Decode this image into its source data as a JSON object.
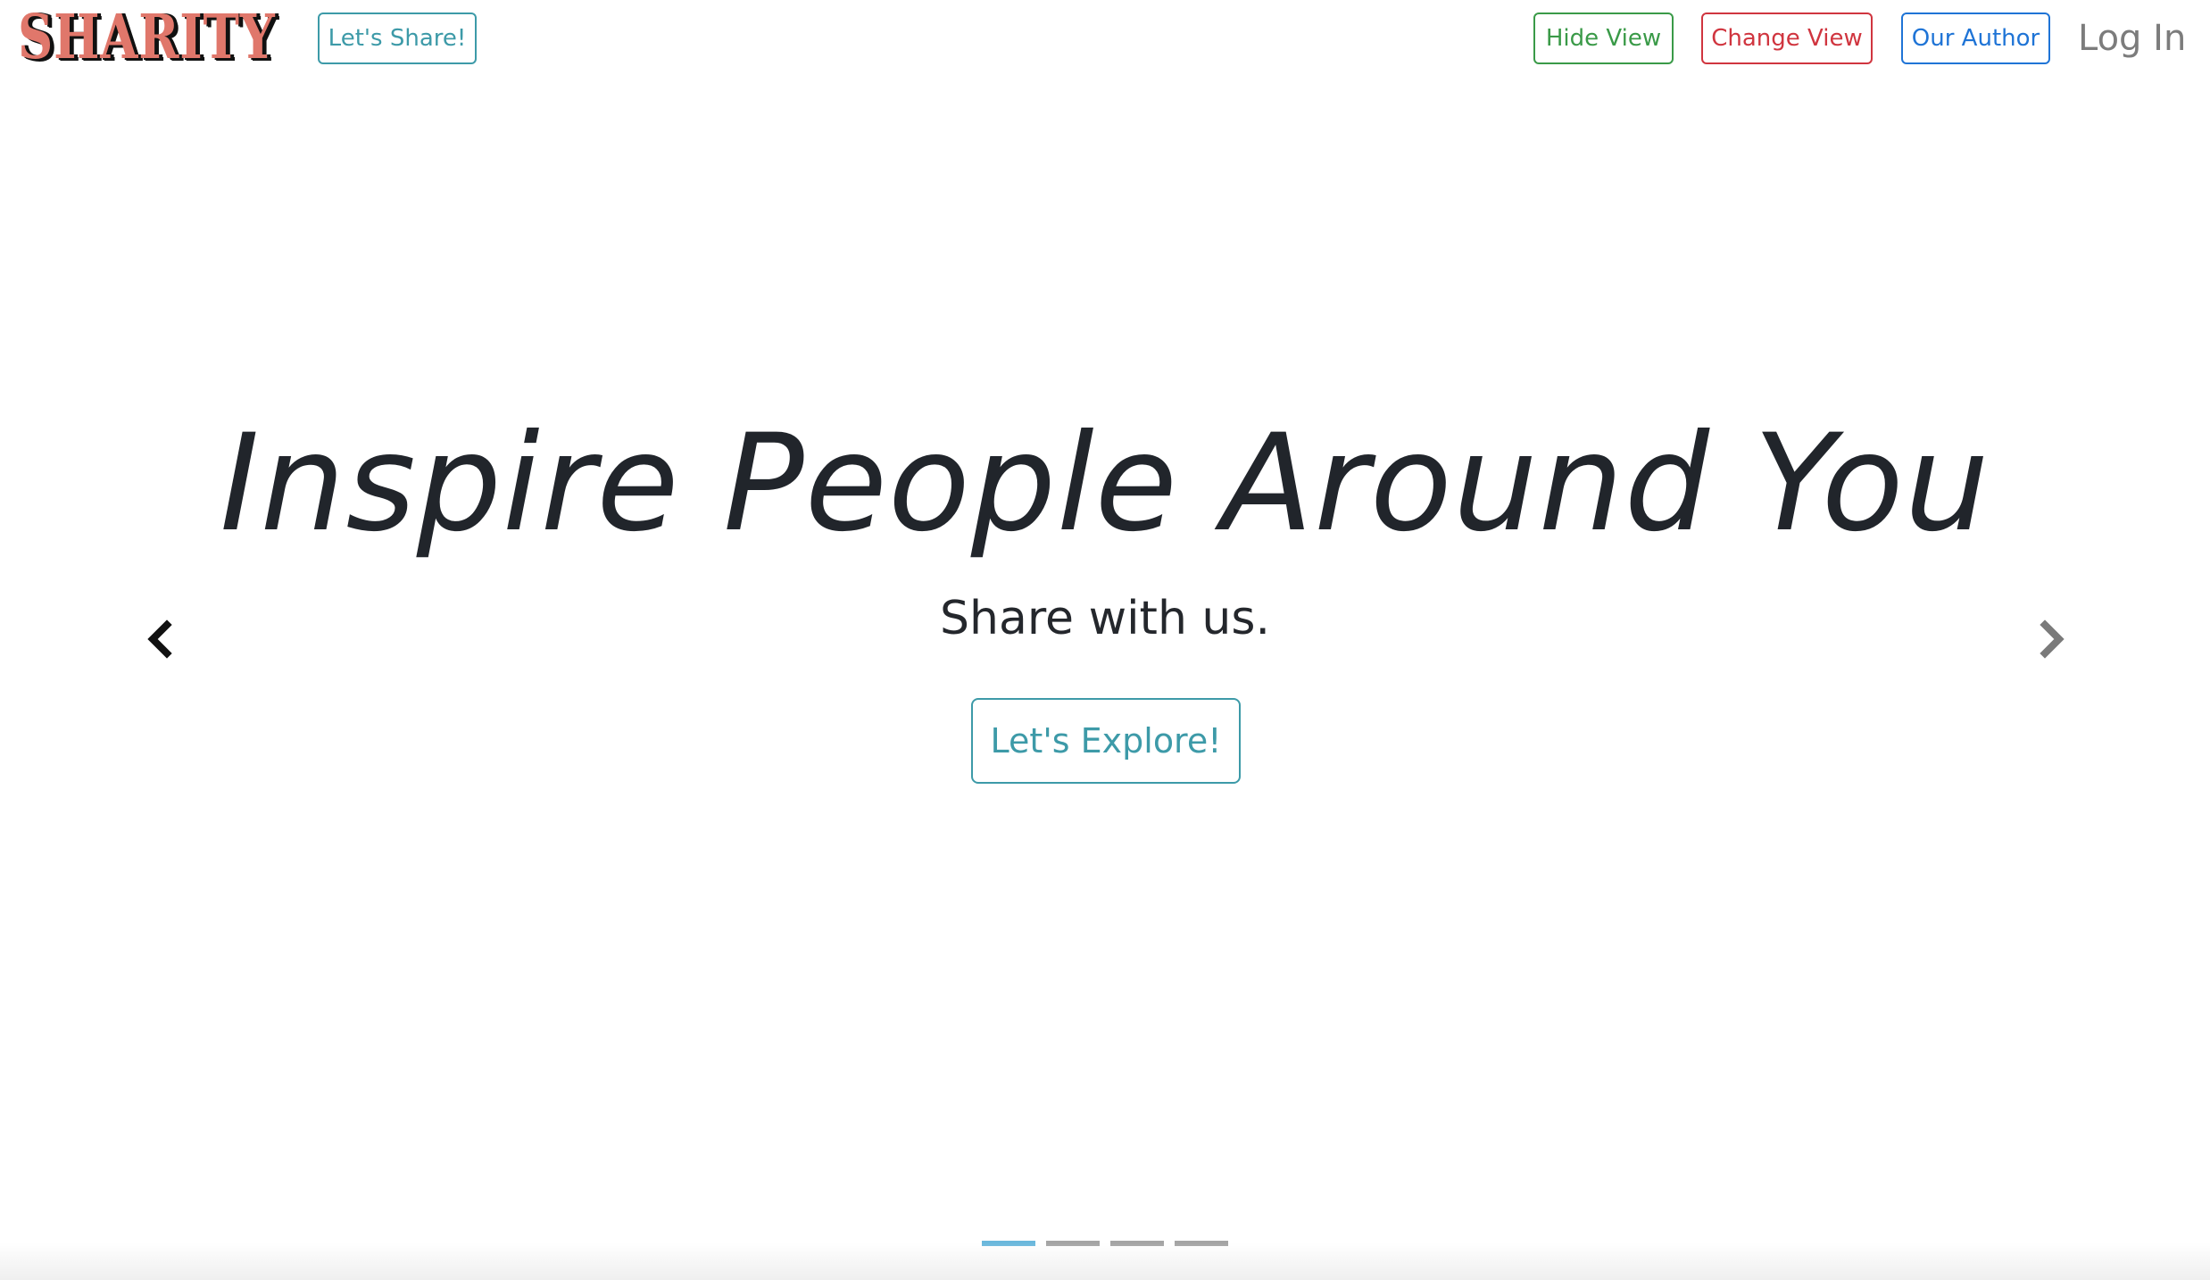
{
  "brand": {
    "name": "SHARITY",
    "colors": {
      "fill": "#e0776b",
      "outline": "#111111"
    }
  },
  "nav": {
    "share_label": "Let's Share!",
    "hide_view_label": "Hide View",
    "change_view_label": "Change View",
    "our_author_label": "Our Author",
    "login_label": "Log In"
  },
  "hero": {
    "title": "Inspire People Around You",
    "subtitle": "Share with us.",
    "explore_label": "Let's Explore!"
  },
  "carousel": {
    "slide_count": 4,
    "active_index": 0,
    "prev_icon": "chevron-left-icon",
    "next_icon": "chevron-right-icon"
  },
  "colors": {
    "teal": "#3d9aa8",
    "green": "#3a9a48",
    "red": "#d0353f",
    "blue": "#1f74d6",
    "muted_gray": "#7c7c7c",
    "indicator_active": "#6ab7dc",
    "indicator_inactive": "#a4a4a4"
  }
}
